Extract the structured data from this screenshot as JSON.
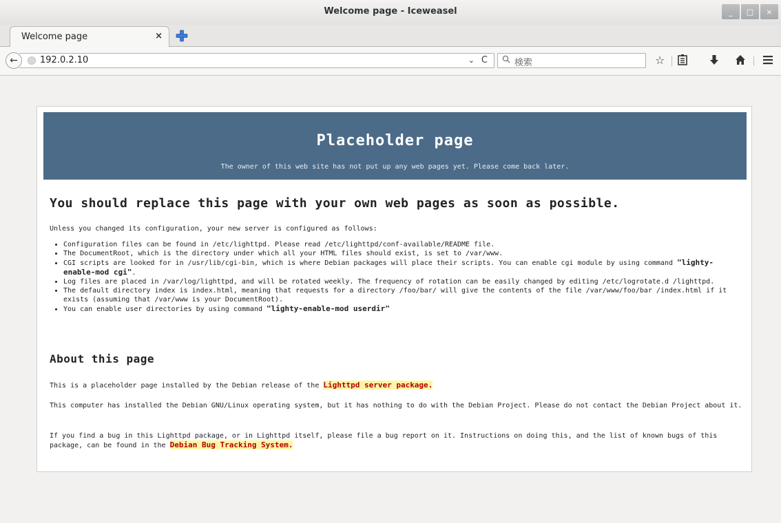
{
  "window": {
    "title": "Welcome page - Iceweasel",
    "buttons": [
      "_",
      "□",
      "×"
    ]
  },
  "tabs": [
    {
      "label": "Welcome page",
      "close": "×"
    }
  ],
  "navbar": {
    "url": "192.0.2.10",
    "dropdown": "⌄",
    "reload": "C",
    "search_placeholder": "検索"
  },
  "page": {
    "banner_title": "Placeholder page",
    "banner_subtitle": "The owner of this web site has not put up any web pages yet. Please come back later.",
    "heading": "You should replace this page with your own web pages as soon as possible.",
    "intro": "Unless you changed its configuration, your new server is configured as follows:",
    "config_items": [
      {
        "text": "Configuration files can be found in /etc/lighttpd. Please read /etc/lighttpd/conf-available/README file.",
        "command": ""
      },
      {
        "text": "The DocumentRoot, which is the directory under which all your HTML files should exist, is set to /var/www.",
        "command": ""
      },
      {
        "text": "CGI scripts are looked for in /usr/lib/cgi-bin, which is where Debian packages will place their scripts. You can enable cgi module by using command ",
        "command": "\"lighty-enable-mod cgi\"",
        "suffix": "."
      },
      {
        "text": "Log files are placed in /var/log/lighttpd, and will be rotated weekly. The frequency of rotation can be easily changed by editing /etc/logrotate.d /lighttpd.",
        "command": ""
      },
      {
        "text": "The default directory index is index.html, meaning that requests for a directory /foo/bar/ will give the contents of the file /var/www/foo/bar /index.html if it exists (assuming that /var/www is your DocumentRoot).",
        "command": ""
      },
      {
        "text": "You can enable user directories by using command ",
        "command": "\"lighty-enable-mod userdir\""
      }
    ],
    "about_heading": "About this page",
    "about_p1_text": "This is a placeholder page installed by the Debian release of the ",
    "about_p1_link": "Lighttpd server package.",
    "about_p2": "This computer has installed the Debian GNU/Linux operating system, but it has nothing to do with the Debian Project. Please do not contact the Debian Project about it.",
    "about_p3_text": "If you find a bug in this Lighttpd package, or in Lighttpd itself, please file a bug report on it. Instructions on doing this, and the list of known bugs of this package, can be found in the ",
    "about_p3_link": "Debian Bug Tracking System."
  },
  "colors": {
    "banner": "#4c6b88",
    "link_highlight": "#fdf5a6",
    "link_text": "#b30000"
  }
}
